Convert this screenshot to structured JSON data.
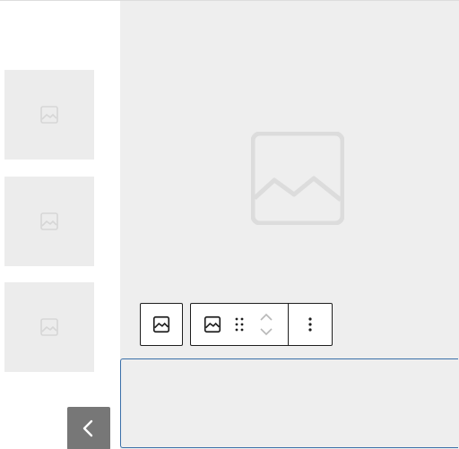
{
  "sidebar": {
    "thumbnails": [
      {
        "icon": "image-placeholder-icon"
      },
      {
        "icon": "image-placeholder-icon"
      },
      {
        "icon": "image-placeholder-icon"
      }
    ],
    "back_button_icon": "chevron-left-icon"
  },
  "canvas": {
    "main_image_icon": "image-placeholder-icon"
  },
  "toolbar": {
    "single_icon": "image-icon",
    "group": {
      "image_icon": "image-icon",
      "drag_icon": "drag-handle-icon",
      "move_up_icon": "chevron-up-icon",
      "move_down_icon": "chevron-down-icon",
      "more_icon": "more-vertical-icon"
    }
  },
  "colors": {
    "placeholder_bg": "#ececec",
    "placeholder_icon": "#dcdcdc",
    "canvas_bg": "#eeeeee",
    "toolbar_border": "#1e1e1e",
    "selection_border": "#3a6fa8",
    "back_button_bg": "#777777"
  }
}
